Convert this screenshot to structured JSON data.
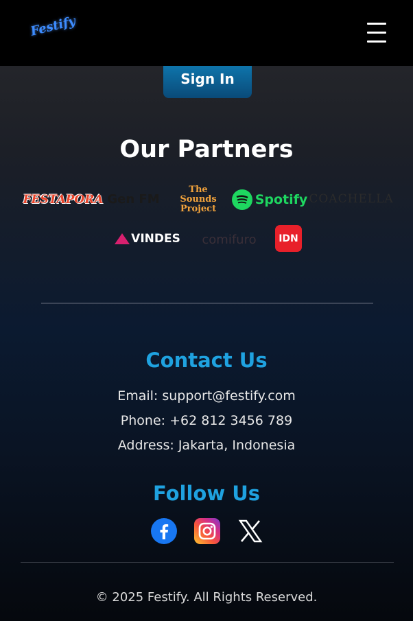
{
  "header": {
    "logo_text": "Festify"
  },
  "auth": {
    "signin_label": "Sign In"
  },
  "partners": {
    "title": "Our Partners",
    "logos": [
      {
        "name": "festapora",
        "text": "FESTAPORA"
      },
      {
        "name": "gen-fm",
        "text": "Gen FM"
      },
      {
        "name": "the-sounds-project",
        "text": "The Sounds Project"
      },
      {
        "name": "spotify",
        "text": "Spotify"
      },
      {
        "name": "coachella",
        "text": "COACHELLA"
      },
      {
        "name": "vindes",
        "text": "VINDES"
      },
      {
        "name": "comifuro",
        "text": "comifuro"
      },
      {
        "name": "idn",
        "text": "IDN"
      }
    ]
  },
  "contact": {
    "title": "Contact Us",
    "email": "Email: support@festify.com",
    "phone": "Phone: +62 812 3456 789",
    "address": "Address: Jakarta, Indonesia"
  },
  "follow": {
    "title": "Follow Us",
    "icons": [
      "facebook-icon",
      "instagram-icon",
      "x-icon"
    ]
  },
  "footer": {
    "copyright": "© 2025 Festify. All Rights Reserved."
  },
  "colors": {
    "accent": "#1fa2e0",
    "signin_bg": "#0f7fb8",
    "header_bg": "#000000"
  }
}
